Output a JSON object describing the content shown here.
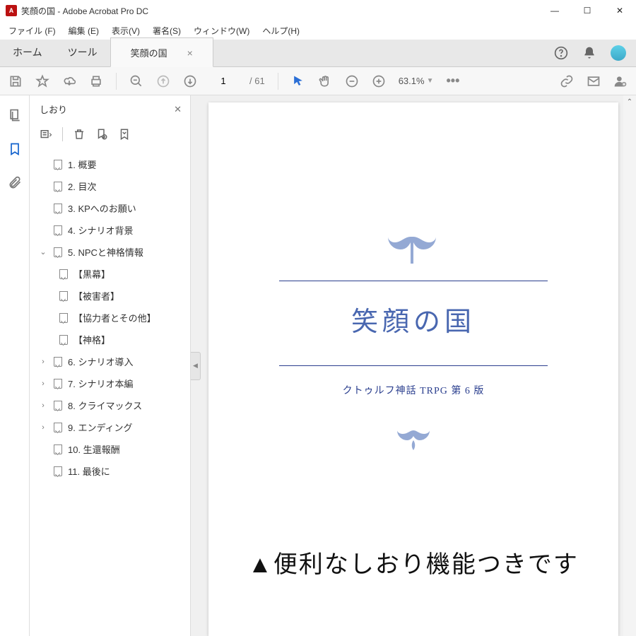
{
  "window": {
    "title": "笑顔の国 - Adobe Acrobat Pro DC",
    "app_icon_label": "A"
  },
  "menu": [
    "ファイル (F)",
    "編集 (E)",
    "表示(V)",
    "署名(S)",
    "ウィンドウ(W)",
    "ヘルプ(H)"
  ],
  "tabs": {
    "home": "ホーム",
    "tools": "ツール",
    "active": "笑顔の国"
  },
  "toolbar": {
    "page_current": "1",
    "page_total": "/ 61",
    "zoom": "63.1%"
  },
  "bookmarks": {
    "panel_title": "しおり",
    "items": [
      {
        "label": "1.  概要",
        "expand": "none"
      },
      {
        "label": "2.  目次",
        "expand": "none"
      },
      {
        "label": "3.  KPへのお願い",
        "expand": "none"
      },
      {
        "label": "4.  シナリオ背景",
        "expand": "none"
      },
      {
        "label": "5.  NPCと神格情報",
        "expand": "open"
      },
      {
        "label": "【黒幕】",
        "child": true
      },
      {
        "label": "【被害者】",
        "child": true
      },
      {
        "label": "【協力者とその他】",
        "child": true
      },
      {
        "label": "【神格】",
        "child": true
      },
      {
        "label": "6.  シナリオ導入",
        "expand": "closed"
      },
      {
        "label": "7.  シナリオ本編",
        "expand": "closed"
      },
      {
        "label": "8.  クライマックス",
        "expand": "closed"
      },
      {
        "label": "9.  エンディング",
        "expand": "closed"
      },
      {
        "label": "10.  生還報酬",
        "expand": "none"
      },
      {
        "label": "11.  最後に",
        "expand": "none"
      }
    ]
  },
  "document": {
    "title": "笑顔の国",
    "subtitle": "クトゥルフ神話 TRPG 第 6 版"
  },
  "caption": "▲便利なしおり機能つきです"
}
